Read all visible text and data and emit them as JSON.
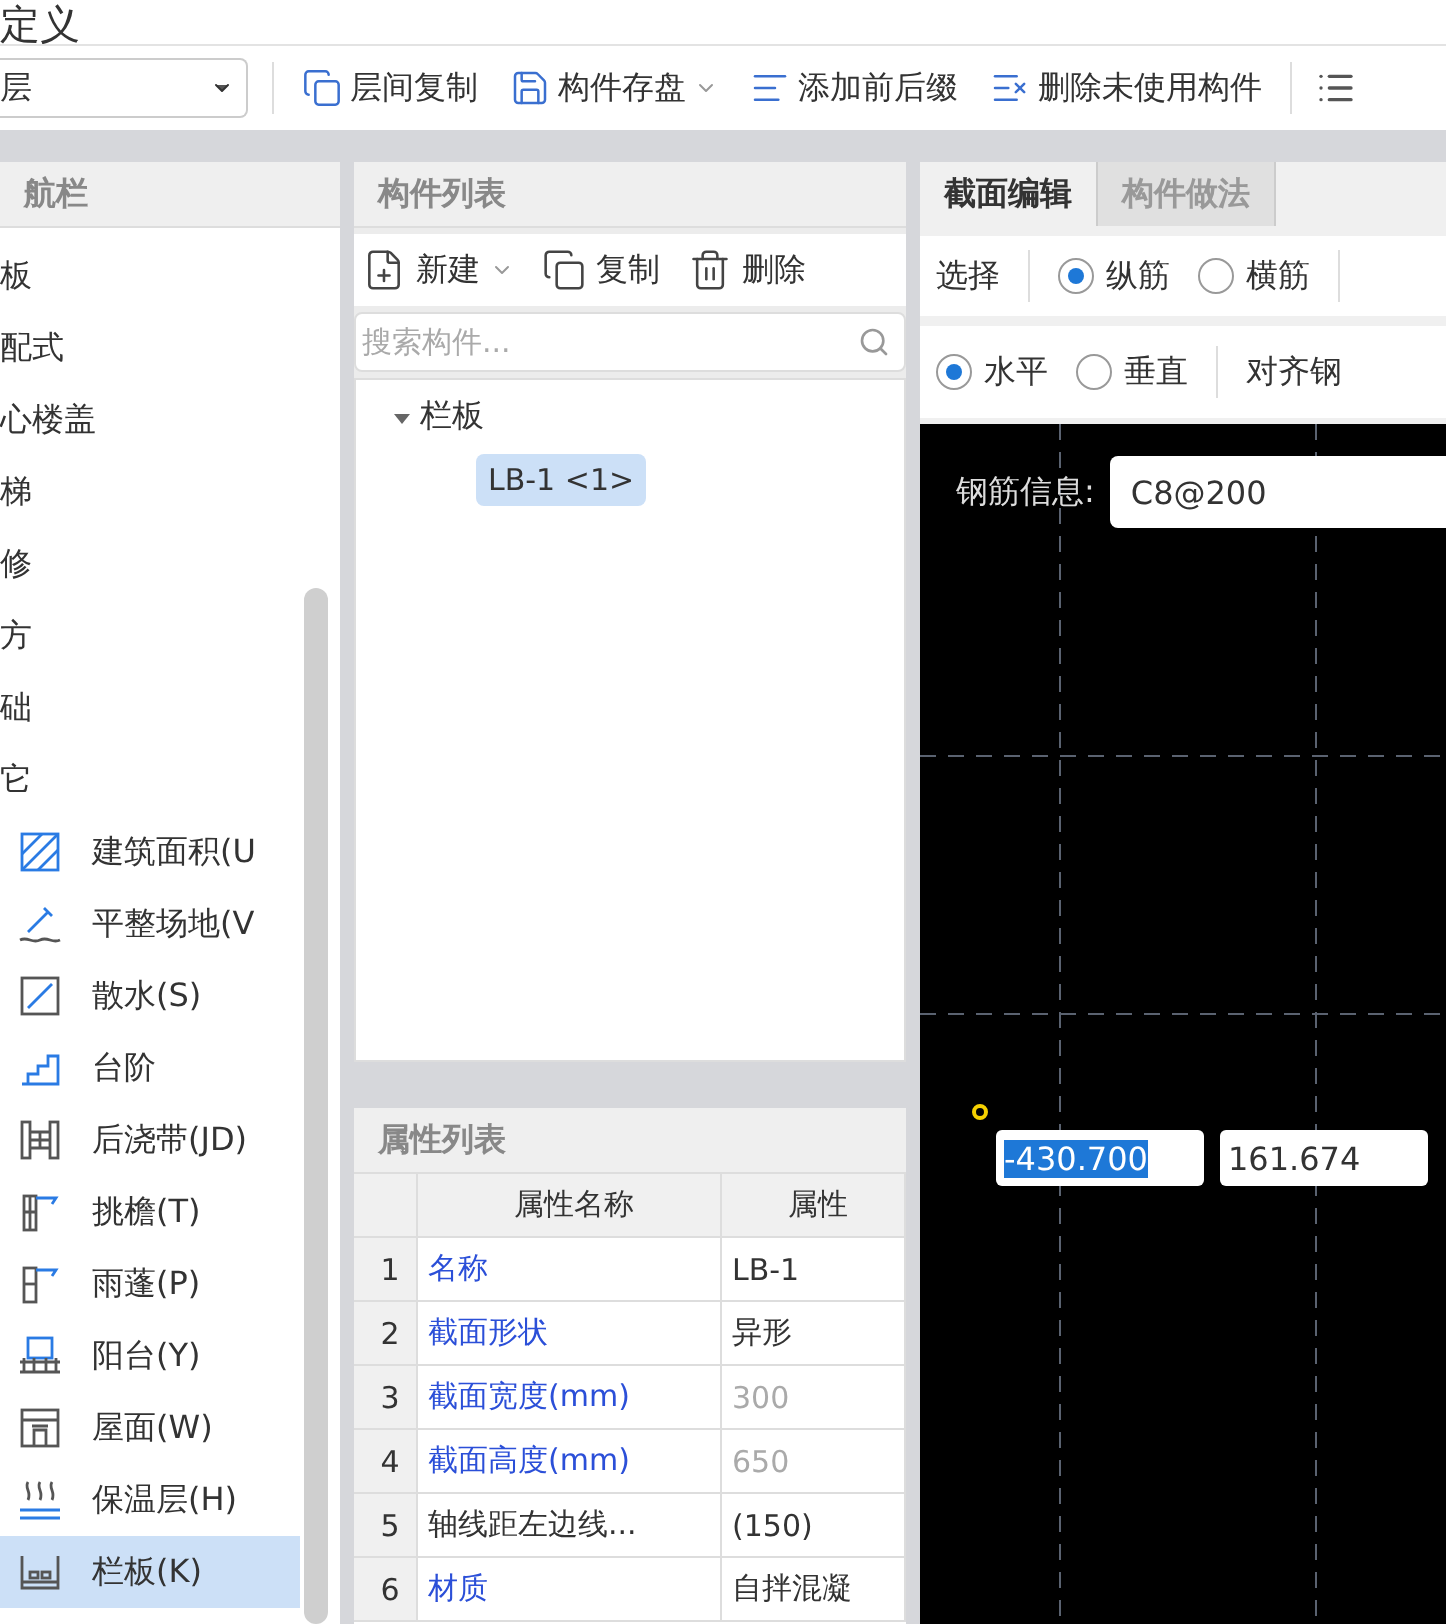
{
  "window": {
    "title": "定义"
  },
  "toolbar": {
    "floor_select": "层",
    "buttons": [
      {
        "label": "层间复制",
        "dropdown": false
      },
      {
        "label": "构件存盘",
        "dropdown": true
      },
      {
        "label": "添加前后缀",
        "dropdown": false
      },
      {
        "label": "删除未使用构件",
        "dropdown": false
      }
    ]
  },
  "nav": {
    "header": "航栏",
    "items": [
      {
        "label": "板",
        "selected": false
      },
      {
        "label": "配式",
        "selected": false
      },
      {
        "label": "心楼盖",
        "selected": false
      },
      {
        "label": "梯",
        "selected": false
      },
      {
        "label": "修",
        "selected": false
      },
      {
        "label": "方",
        "selected": false
      },
      {
        "label": "础",
        "selected": false
      },
      {
        "label": "它",
        "selected": false,
        "children": [
          {
            "label": "建筑面积(U",
            "selected": false
          },
          {
            "label": "平整场地(V",
            "selected": false
          },
          {
            "label": "散水(S)",
            "selected": false
          },
          {
            "label": "台阶",
            "selected": false
          },
          {
            "label": "后浇带(JD)",
            "selected": false
          },
          {
            "label": "挑檐(T)",
            "selected": false
          },
          {
            "label": "雨蓬(P)",
            "selected": false
          },
          {
            "label": "阳台(Y)",
            "selected": false
          },
          {
            "label": "屋面(W)",
            "selected": false
          },
          {
            "label": "保温层(H)",
            "selected": false
          },
          {
            "label": "栏板(K)",
            "selected": true
          }
        ]
      }
    ]
  },
  "component_list": {
    "header": "构件列表",
    "actions": [
      {
        "label": "新建",
        "dropdown": true
      },
      {
        "label": "复制",
        "dropdown": false
      },
      {
        "label": "删除",
        "dropdown": false
      }
    ],
    "search": {
      "placeholder": "搜索构件..."
    },
    "tree": [
      {
        "label": "栏板",
        "expanded": true,
        "children": [
          {
            "label": "LB-1 <1>",
            "selected": true
          }
        ]
      }
    ]
  },
  "property_list": {
    "header": "属性列表",
    "columns": [
      "属性名称",
      "属性"
    ],
    "rows": [
      {
        "index": "1",
        "name": "名称",
        "value": "LB-1",
        "public": true,
        "value_disabled": false
      },
      {
        "index": "2",
        "name": "截面形状",
        "value": "异形",
        "public": true,
        "value_disabled": false
      },
      {
        "index": "3",
        "name": "截面宽度(mm)",
        "value": "300",
        "public": true,
        "value_disabled": true
      },
      {
        "index": "4",
        "name": "截面高度(mm)",
        "value": "650",
        "public": true,
        "value_disabled": true
      },
      {
        "index": "5",
        "name": "轴线距左边线...",
        "value": "(150)",
        "public": false,
        "value_disabled": false
      },
      {
        "index": "6",
        "name": "材质",
        "value": "自拌混凝",
        "public": true,
        "value_disabled": false
      }
    ]
  },
  "editor": {
    "tabs": [
      {
        "label": "截面编辑",
        "selected": true
      },
      {
        "label": "构件做法",
        "selected": false
      }
    ],
    "select_label": "选择",
    "bar_type": [
      {
        "label": "纵筋",
        "selected": true
      },
      {
        "label": "横筋",
        "selected": false
      }
    ],
    "direction": [
      {
        "label": "水平",
        "selected": true
      },
      {
        "label": "垂直",
        "selected": false
      }
    ],
    "align_label": "对齐钢",
    "rebar_info": {
      "label": "钢筋信息:",
      "value": "C8@200"
    },
    "coordinates": [
      {
        "value": "-430.700",
        "selected": true
      },
      {
        "value": "161.674",
        "selected": false
      }
    ]
  }
}
